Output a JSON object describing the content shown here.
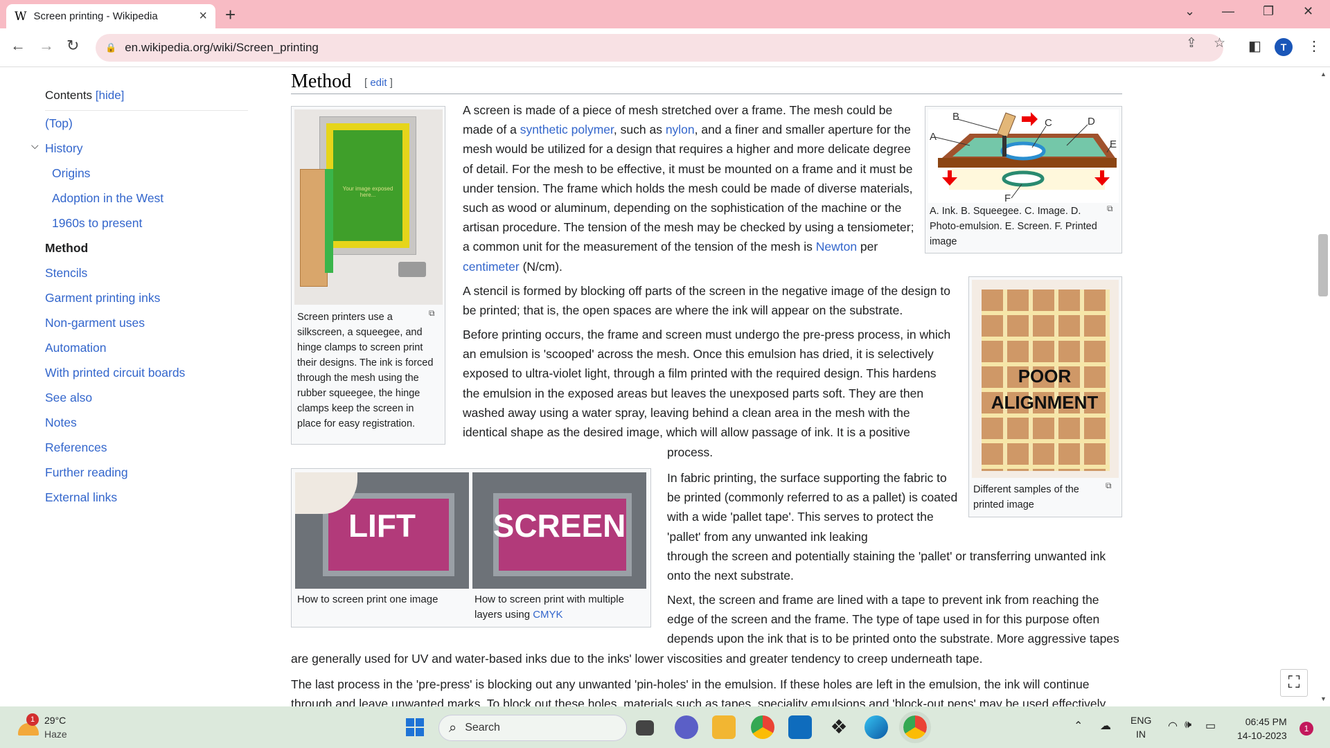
{
  "browser": {
    "tab_title": "Screen printing - Wikipedia",
    "tab_favicon": "W",
    "url": "en.wikipedia.org/wiki/Screen_printing",
    "profile_initial": "T"
  },
  "toc": {
    "heading": "Contents",
    "hide_label": "[hide]",
    "items": [
      "(Top)",
      "History",
      "Origins",
      "Adoption in the West",
      "1960s to present",
      "Method",
      "Stencils",
      "Garment printing inks",
      "Non-garment uses",
      "Automation",
      "With printed circuit boards",
      "See also",
      "Notes",
      "References",
      "Further reading",
      "External links"
    ]
  },
  "article": {
    "section_title": "Method",
    "edit_label": "edit",
    "image1_text": "Your image exposed here...",
    "caption1": "Screen printers use a silkscreen, a squeegee, and hinge clamps to screen print their designs. The ink is forced through the mesh using the rubber squeegee, the hinge clamps keep the screen in place for easy registration.",
    "diagram_labels": [
      "A",
      "B",
      "C",
      "D",
      "E",
      "F"
    ],
    "caption2": "A. Ink. B. Squeegee. C. Image. D. Photo-emulsion. E. Screen. F. Printed image",
    "poor_line1": "POOR",
    "poor_line2": "ALIGNMENT",
    "caption3": "Different samples of the printed image",
    "lift_label": "LIFT",
    "screen_label": "SCREEN",
    "caption_lift": "How to screen print one image",
    "caption_screen_pre": "How to screen print with multiple layers using ",
    "caption_screen_link": "CMYK",
    "p1": {
      "a": "A screen is made of a piece of mesh stretched over a frame. The mesh could be made of a ",
      "l1": "synthetic polymer",
      "b": ", such as ",
      "l2": "nylon",
      "c": ", and a finer and smaller aperture for the mesh would be utilized for a design that requires a higher and more delicate degree of detail. For the mesh to be effective, it must be mounted on a frame and it must be under tension. The frame which holds the mesh could be made of diverse materials, such as wood or aluminum, depending on the sophistication of the machine or the artisan procedure. The tension of the mesh may be checked by using a tensiometer; a common unit for the measurement of the tension of the mesh is ",
      "l3": "Newton",
      "d": " per ",
      "l4": "centimeter",
      "e": " (N/cm)."
    },
    "p2": "A stencil is formed by blocking off parts of the screen in the negative image of the design to be printed; that is, the open spaces are where the ink will appear on the substrate.",
    "p3": "Before printing occurs, the frame and screen must undergo the pre-press process, in which an emulsion is 'scooped' across the mesh. Once this emulsion has dried, it is selectively exposed to ultra-violet light, through a film printed with the required design. This hardens the emulsion in the exposed areas but leaves the unexposed parts soft. They are then washed away using a water spray, leaving behind a clean area in the mesh with the identical shape as the desired image, which will allow passage of ink. It is a positive",
    "p3_end": "process.",
    "p4": "In fabric printing, the surface supporting the fabric to be printed (commonly referred to as a pallet) is coated with a wide 'pallet tape'. This serves to protect the 'pallet' from any unwanted ink leaking",
    "p4_end": "through the screen and potentially staining the 'pallet' or transferring unwanted ink onto the next substrate.",
    "p5a": "Next, the screen and frame are lined with a tape to prevent ink from reaching the edge of the screen and the frame. The type of tape used in for this purpose often depends upon the ink that is to be printed onto the substrate. More aggressive tapes",
    "p5b": "are generally used for UV and water-based inks due to the inks' lower viscosities and greater tendency to creep underneath tape.",
    "p6": "The last process in the 'pre-press' is blocking out any unwanted 'pin-holes' in the emulsion. If these holes are left in the emulsion, the ink will continue through and leave unwanted marks. To block out these holes, materials such as tapes, speciality emulsions and 'block-out pens' may be used effectively"
  },
  "taskbar": {
    "temperature": "29°C",
    "weather": "Haze",
    "weather_badge": "1",
    "search_label": "Search",
    "lang1": "ENG",
    "lang2": "IN",
    "time": "06:45 PM",
    "date": "14-10-2023",
    "notification_count": "1"
  }
}
